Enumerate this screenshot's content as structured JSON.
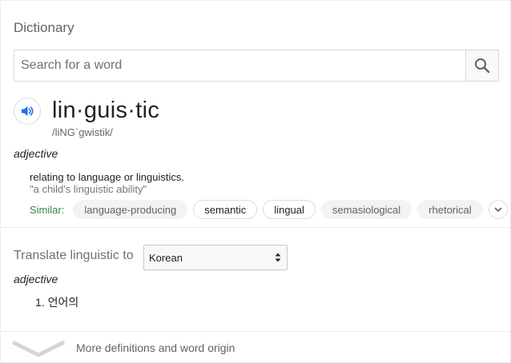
{
  "dictionary": {
    "title": "Dictionary",
    "search": {
      "placeholder": "Search for a word",
      "value": ""
    },
    "entry": {
      "word": "lin·guis·tic",
      "phonetic": "/liNGˈgwistik/",
      "part_of_speech": "adjective",
      "definition": "relating to language or linguistics.",
      "example": "\"a child's linguistic ability\"",
      "similar_label": "Similar:",
      "similar": [
        {
          "label": "language-producing",
          "style": "filled"
        },
        {
          "label": "semantic",
          "style": "outlined"
        },
        {
          "label": "lingual",
          "style": "outlined"
        },
        {
          "label": "semasiological",
          "style": "filled"
        },
        {
          "label": "rhetorical",
          "style": "filled"
        }
      ]
    },
    "translate": {
      "label": "Translate linguistic to",
      "language": "Korean",
      "part_of_speech": "adjective",
      "results": [
        "1. 언어의"
      ]
    },
    "footer": {
      "more_label": "More definitions and word origin"
    },
    "icons": {
      "search": "search-icon",
      "speaker": "speaker-icon",
      "expand": "chevron-down-icon",
      "select": "updown-arrows-icon",
      "more": "chevron-down-icon"
    },
    "colors": {
      "accent_blue": "#1a73e8",
      "similar_green": "#2e8b45",
      "chip_filled_bg": "#f1f3f4"
    }
  }
}
